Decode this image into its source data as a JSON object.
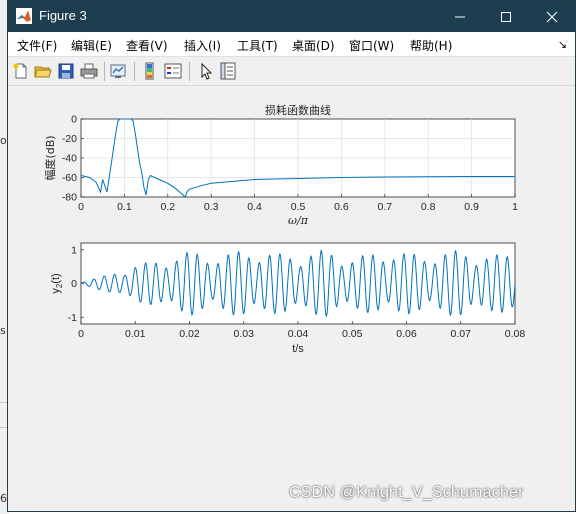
{
  "window": {
    "title": "Figure 3"
  },
  "menu": [
    "文件(F)",
    "编辑(E)",
    "查看(V)",
    "插入(I)",
    "工具(T)",
    "桌面(D)",
    "窗口(W)",
    "帮助(H)"
  ],
  "background": {
    "left_text_1": "o",
    "left_text_2": "s",
    "left_text_3": "6"
  },
  "toolbar": [
    "new-figure-icon",
    "open-file-icon",
    "save-icon",
    "print-icon",
    "link-plot-icon",
    "insert-colorbar-icon",
    "insert-legend-icon",
    "edit-plot-icon",
    "property-inspector-icon"
  ],
  "watermark": "CSDN @Knight_V_Schumacher",
  "colors": {
    "line": "#0072bd",
    "titlebar": "#1d3e4e",
    "grid": "#dfdfdf"
  },
  "chart_data": [
    {
      "type": "line",
      "title": "损耗函数曲线",
      "xlabel": "ω/π",
      "ylabel": "幅度(dB)",
      "xlim": [
        0,
        1
      ],
      "ylim": [
        -80,
        0
      ],
      "xticks": [
        "0",
        "0.1",
        "0.2",
        "0.3",
        "0.4",
        "0.5",
        "0.6",
        "0.7",
        "0.8",
        "0.9",
        "1"
      ],
      "yticks": [
        "0",
        "-20",
        "-40",
        "-60",
        "-80"
      ],
      "grid": true,
      "x": [
        0,
        0.02,
        0.035,
        0.045,
        0.05,
        0.06,
        0.07,
        0.075,
        0.08,
        0.085,
        0.09,
        0.095,
        0.1,
        0.105,
        0.11,
        0.115,
        0.12,
        0.125,
        0.13,
        0.135,
        0.14,
        0.145,
        0.15,
        0.155,
        0.16,
        0.18,
        0.2,
        0.22,
        0.24,
        0.245,
        0.25,
        0.28,
        0.3,
        0.35,
        0.4,
        0.5,
        0.6,
        0.7,
        0.8,
        0.9,
        1.0
      ],
      "y": [
        -58,
        -60,
        -65,
        -75,
        -62,
        -75,
        -45,
        -30,
        -15,
        -2,
        0,
        0,
        0,
        0,
        0,
        0,
        -2,
        -15,
        -30,
        -45,
        -55,
        -70,
        -78,
        -62,
        -58,
        -62,
        -66,
        -72,
        -80,
        -74,
        -72,
        -68,
        -66,
        -64,
        -62,
        -61,
        -60,
        -59.5,
        -59.2,
        -59,
        -59
      ]
    },
    {
      "type": "line",
      "title": "",
      "xlabel": "t/s",
      "ylabel": "y2(t)",
      "ylabel_main": "y",
      "ylabel_sub": "2",
      "ylabel_rest": "(t)",
      "xlim": [
        0,
        0.08
      ],
      "ylim": [
        -1.2,
        1.2
      ],
      "xticks": [
        "0",
        "0.01",
        "0.02",
        "0.03",
        "0.04",
        "0.05",
        "0.06",
        "0.07",
        "0.08"
      ],
      "yticks": [
        "1",
        "0",
        "-1"
      ],
      "grid": false,
      "x": [
        0,
        0.005,
        0.01,
        0.015,
        0.02,
        0.025,
        0.03,
        0.035,
        0.04,
        0.045,
        0.05,
        0.055,
        0.06,
        0.065,
        0.07,
        0.075,
        0.08
      ],
      "envelope": [
        0.05,
        0.25,
        0.55,
        0.7,
        0.95,
        0.8,
        1.0,
        0.9,
        0.85,
        1.0,
        0.75,
        0.95,
        0.9,
        0.85,
        1.0,
        0.8,
        0.95
      ],
      "cycles": 42
    }
  ]
}
